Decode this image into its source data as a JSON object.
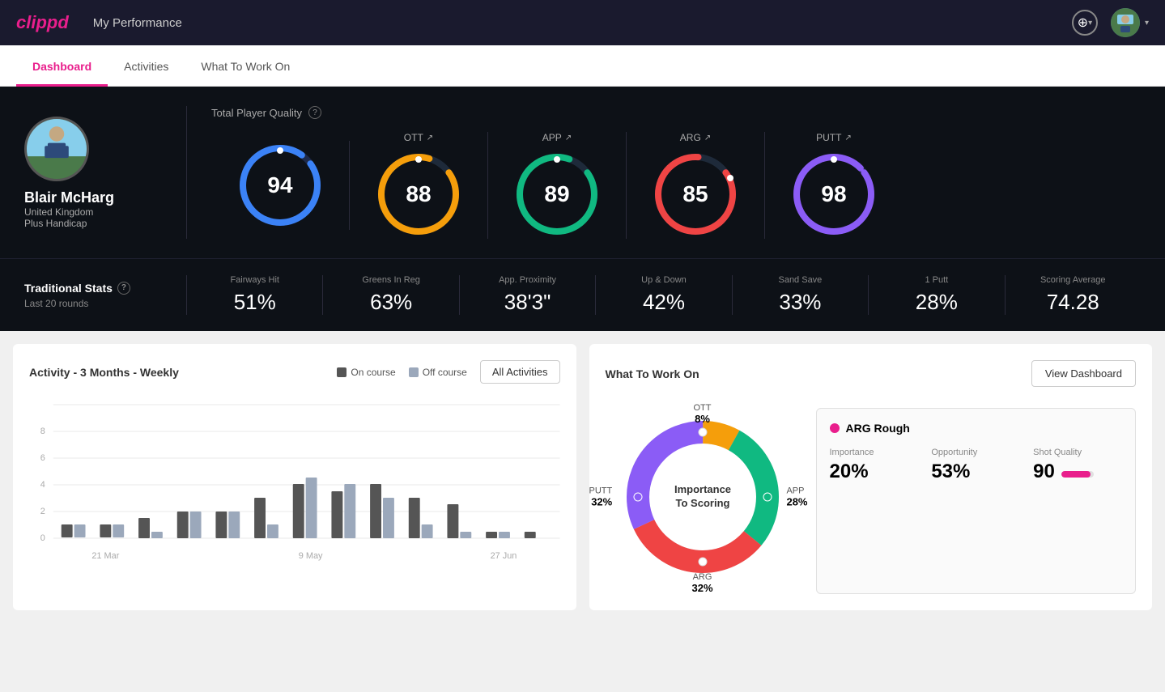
{
  "app": {
    "logo": "clippd",
    "header_title": "My Performance"
  },
  "nav": {
    "tabs": [
      {
        "label": "Dashboard",
        "active": true
      },
      {
        "label": "Activities",
        "active": false
      },
      {
        "label": "What To Work On",
        "active": false
      }
    ]
  },
  "player": {
    "name": "Blair McHarg",
    "country": "United Kingdom",
    "handicap": "Plus Handicap"
  },
  "quality": {
    "title": "Total Player Quality",
    "total": {
      "value": "94",
      "color": "#3b82f6"
    },
    "metrics": [
      {
        "label": "OTT",
        "value": "88",
        "color": "#f59e0b"
      },
      {
        "label": "APP",
        "value": "89",
        "color": "#10b981"
      },
      {
        "label": "ARG",
        "value": "85",
        "color": "#ef4444"
      },
      {
        "label": "PUTT",
        "value": "98",
        "color": "#8b5cf6"
      }
    ]
  },
  "trad_stats": {
    "title": "Traditional Stats",
    "subtitle": "Last 20 rounds",
    "stats": [
      {
        "label": "Fairways Hit",
        "value": "51%"
      },
      {
        "label": "Greens In Reg",
        "value": "63%"
      },
      {
        "label": "App. Proximity",
        "value": "38'3\""
      },
      {
        "label": "Up & Down",
        "value": "42%"
      },
      {
        "label": "Sand Save",
        "value": "33%"
      },
      {
        "label": "1 Putt",
        "value": "28%"
      },
      {
        "label": "Scoring Average",
        "value": "74.28"
      }
    ]
  },
  "activity_chart": {
    "title": "Activity - 3 Months - Weekly",
    "legend": {
      "on_course": "On course",
      "off_course": "Off course"
    },
    "all_activities_btn": "All Activities",
    "x_labels": [
      "21 Mar",
      "9 May",
      "27 Jun"
    ],
    "y_labels": [
      "0",
      "2",
      "4",
      "6",
      "8"
    ],
    "bars": [
      {
        "on": 1,
        "off": 1
      },
      {
        "on": 1,
        "off": 1
      },
      {
        "on": 1.5,
        "off": 0.5
      },
      {
        "on": 2,
        "off": 2
      },
      {
        "on": 2,
        "off": 2
      },
      {
        "on": 3,
        "off": 1
      },
      {
        "on": 4,
        "off": 4.5
      },
      {
        "on": 3.5,
        "off": 4
      },
      {
        "on": 4,
        "off": 3
      },
      {
        "on": 3,
        "off": 1
      },
      {
        "on": 2.5,
        "off": 0.5
      },
      {
        "on": 0.5,
        "off": 0.5
      },
      {
        "on": 0.5,
        "off": 0
      }
    ]
  },
  "work_on": {
    "title": "What To Work On",
    "view_dashboard_btn": "View Dashboard",
    "center_label1": "Importance",
    "center_label2": "To Scoring",
    "segments": [
      {
        "label": "OTT",
        "pct": "8%",
        "color": "#f59e0b"
      },
      {
        "label": "APP",
        "pct": "28%",
        "color": "#10b981"
      },
      {
        "label": "ARG",
        "pct": "32%",
        "color": "#ef4444"
      },
      {
        "label": "PUTT",
        "pct": "32%",
        "color": "#8b5cf6"
      }
    ],
    "detail": {
      "name": "ARG Rough",
      "importance_label": "Importance",
      "importance_value": "20%",
      "opportunity_label": "Opportunity",
      "opportunity_value": "53%",
      "shot_quality_label": "Shot Quality",
      "shot_quality_value": "90"
    }
  }
}
